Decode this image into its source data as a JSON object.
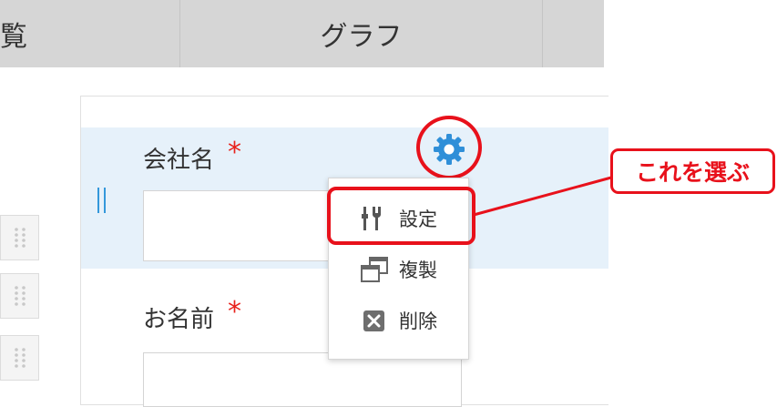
{
  "tabs": [
    {
      "label": "覧"
    },
    {
      "label": "グラフ"
    },
    {
      "label": ""
    }
  ],
  "form": {
    "fields": [
      {
        "label": "会社名",
        "required_mark": "*",
        "value": ""
      },
      {
        "label": "お名前",
        "required_mark": "*",
        "value": ""
      }
    ]
  },
  "field_menu": {
    "gear_icon": "gear-icon",
    "items": [
      {
        "label": "設定",
        "icon": "settings-tools-icon"
      },
      {
        "label": "複製",
        "icon": "duplicate-icon"
      },
      {
        "label": "削除",
        "icon": "delete-icon"
      }
    ]
  },
  "annotation": {
    "callout_text": "これを選ぶ"
  },
  "colors": {
    "accent_blue": "#2f8fd8",
    "highlight_red": "#e8111b",
    "required_red": "#e8221c",
    "selected_row": "#e6f1fa"
  }
}
